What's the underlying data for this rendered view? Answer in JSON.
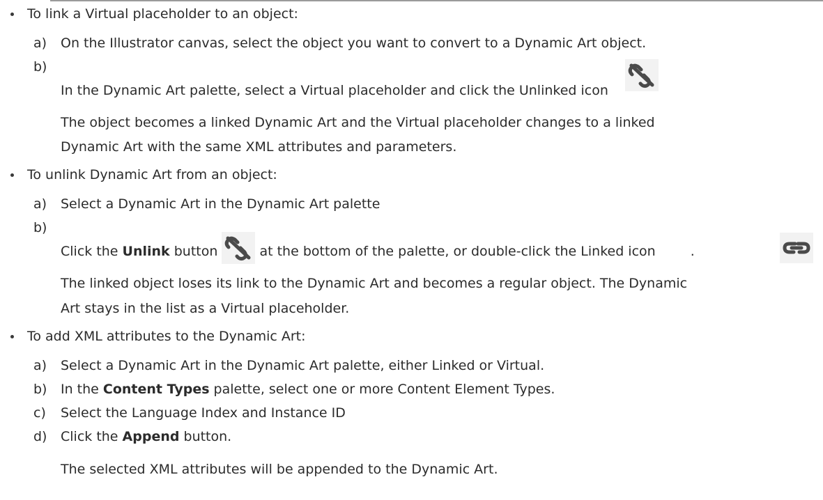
{
  "sections": [
    {
      "heading": "To link a Virtual placeholder to an object:",
      "steps": [
        {
          "marker": "a)",
          "text": "On the Illustrator canvas, select the object you want to convert to a Dynamic Art object."
        },
        {
          "marker": "b)",
          "text": "In the Dynamic Art palette, select a Virtual placeholder and click the Unlinked icon",
          "icon": "unlinked-chain-icon"
        }
      ],
      "result": [
        "The object becomes a linked Dynamic Art and the Virtual placeholder changes to a linked",
        "Dynamic Art with the same XML attributes and parameters."
      ]
    },
    {
      "heading": "To unlink Dynamic Art from an object:",
      "steps": [
        {
          "marker": "a)",
          "text": "Select a Dynamic Art in the Dynamic Art palette"
        },
        {
          "marker": "b)",
          "parts": [
            "Click the ",
            "Unlink",
            " button",
            " at the bottom of the palette, or double-click the Linked icon",
            "."
          ],
          "icons": [
            "unlinked-chain-icon",
            "linked-chain-icon"
          ]
        }
      ],
      "result": [
        "The linked object loses its link to the Dynamic Art and becomes a regular object. The Dynamic",
        "Art stays in the list as a Virtual placeholder."
      ]
    },
    {
      "heading": "To add XML attributes to the Dynamic Art:",
      "steps": [
        {
          "marker": "a)",
          "text": "Select a Dynamic Art in the Dynamic Art palette, either Linked or Virtual."
        },
        {
          "marker": "b)",
          "parts": [
            "In the ",
            "Content Types",
            " palette, select one or more Content Element Types."
          ]
        },
        {
          "marker": "c)",
          "text": "Select the Language Index and Instance ID"
        },
        {
          "marker": "d)",
          "parts": [
            "Click the ",
            "Append",
            " button."
          ]
        }
      ],
      "result": [
        "The selected XML attributes will be appended to the Dynamic Art."
      ]
    }
  ]
}
